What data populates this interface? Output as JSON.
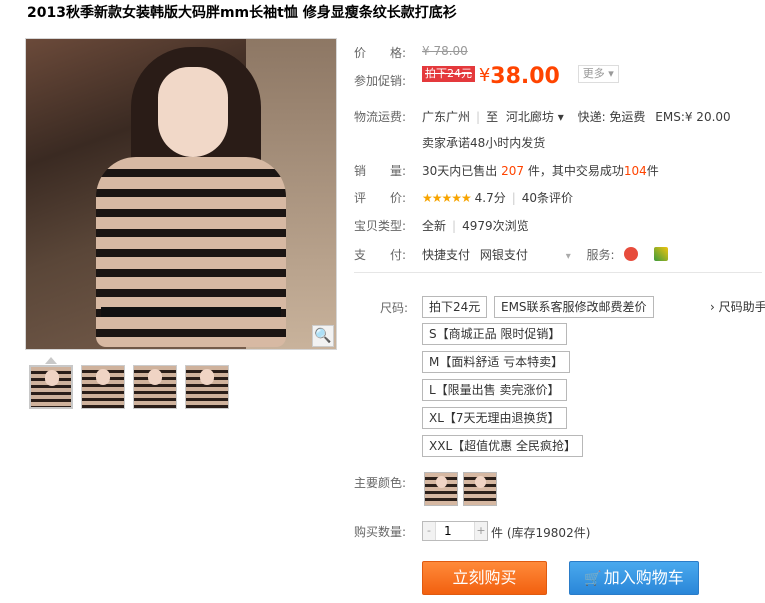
{
  "product": {
    "title": "2013秋季新款女装韩版大码胖mm长袖t恤 修身显瘦条纹长款打底衫"
  },
  "gallery": {
    "zoom_icon": "magnifier-icon",
    "thumbnail_count": 4
  },
  "price": {
    "label": "价　　格:",
    "original": "¥ 78.00"
  },
  "promo": {
    "label": "参加促销:",
    "tag": "拍下24元",
    "currency": "¥",
    "price": "38.00",
    "more": "更多 ▾"
  },
  "shipping": {
    "label": "物流运费:",
    "from": "广东广州",
    "to_prefix": "至",
    "to": "河北廊坊 ▾",
    "express": "快递: 免运费",
    "ems": "EMS:¥ 20.00",
    "promise": "卖家承诺48小时内发货"
  },
  "sales": {
    "label": "销　　量:",
    "prefix": "30天内已售出",
    "sold": "207",
    "middle": "件，其中交易成功",
    "success": "104",
    "suffix": "件"
  },
  "rating": {
    "label": "评　　价:",
    "stars": "★★★★★",
    "score": "4.7分",
    "reviews": "40条评价"
  },
  "item_type": {
    "label": "宝贝类型:",
    "condition": "全新",
    "views": "4979次浏览"
  },
  "payment": {
    "label": "支　　付:",
    "method1": "快捷支付",
    "method2": "网银支付",
    "service_label": "服务:"
  },
  "sizes": {
    "label": "尺码:",
    "helper": "› 尺码助手",
    "row1": [
      "拍下24元",
      "EMS联系客服修改邮费差价"
    ],
    "options": [
      "S【商城正品 限时促销】",
      "M【面料舒适 亏本特卖】",
      "L【限量出售 卖完涨价】",
      "XL【7天无理由退换货】",
      "XXL【超值优惠 全民疯抢】"
    ]
  },
  "colors": {
    "label": "主要颜色:"
  },
  "quantity": {
    "label": "购买数量:",
    "value": "1",
    "unit": "件",
    "stock": "(库存19802件)"
  },
  "actions": {
    "buy_now": "立刻购买",
    "add_to_cart": "加入购物车"
  },
  "colors_palette": {
    "accent": "#ff4400",
    "buy_button": "#f2600f",
    "cart_button": "#2a86d8"
  }
}
